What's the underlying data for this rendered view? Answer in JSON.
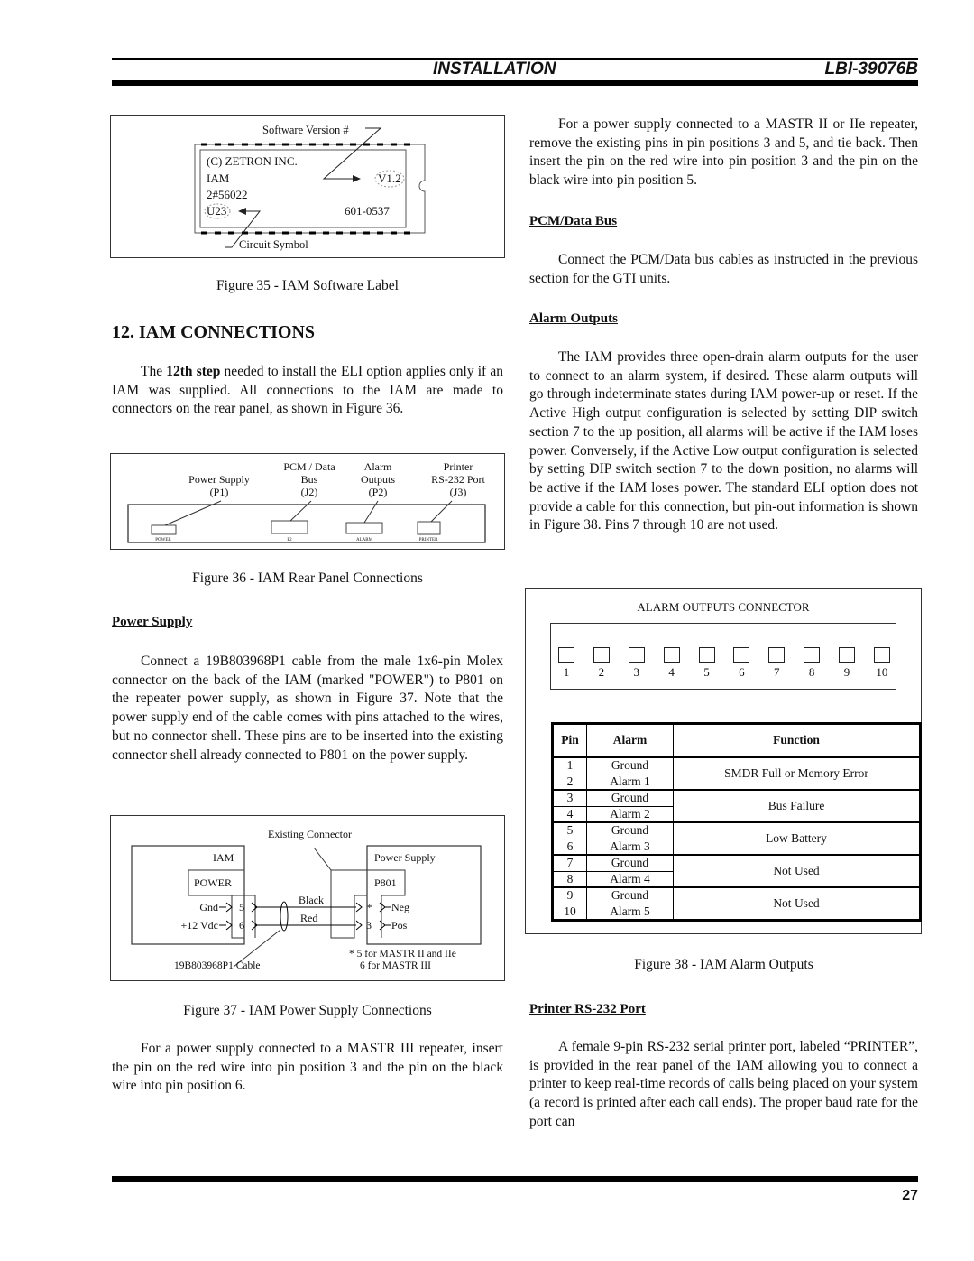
{
  "header": {
    "section": "INSTALLATION",
    "doc_number": "LBI-39076B"
  },
  "footer": {
    "page_number": "27"
  },
  "figure35": {
    "caption": "Figure 35 - IAM Software Label",
    "software_version_label": "Software Version #",
    "circuit_symbol_label": "Circuit Symbol",
    "chip_lines": [
      "(C) ZETRON INC.",
      "IAM",
      "2#56022",
      "U23"
    ],
    "version": "V1.2",
    "part_number": "601-0537"
  },
  "section12": {
    "title": "12. IAM CONNECTIONS",
    "intro_pre": "The ",
    "intro_bold": "12th step",
    "intro_post": " needed to install the ELI option applies only if an IAM was supplied.  All connections to the IAM are made to connectors on the rear panel, as shown in Figure 36."
  },
  "figure36": {
    "caption": "Figure 36 - IAM Rear Panel Connections",
    "connectors": [
      {
        "title_lines": [
          "Power Supply"
        ],
        "id": "(P1)",
        "panel_label": "POWER"
      },
      {
        "title_lines": [
          "PCM / Data",
          "Bus"
        ],
        "id": "(J2)",
        "panel_label": "P2"
      },
      {
        "title_lines": [
          "Alarm",
          "Outputs"
        ],
        "id": "(P2)",
        "panel_label": "ALARM"
      },
      {
        "title_lines": [
          "Printer",
          "RS-232 Port"
        ],
        "id": "(J3)",
        "panel_label": "PRINTER"
      }
    ]
  },
  "power_supply": {
    "heading": "Power Supply",
    "body": "Connect a 19B803968P1 cable from the male 1x6-pin Molex connector on the back of the IAM (marked \"POWER\") to P801 on the repeater power supply, as shown in Figure 37.  Note that the power supply end of the cable comes with pins attached to the wires, but no connector shell.  These pins are to be inserted into the existing connector shell already connected to P801 on the power supply."
  },
  "figure37": {
    "caption": "Figure 37 - IAM Power Supply Connections",
    "existing_connector": "Existing Connector",
    "iam_label": "IAM",
    "power_label": "POWER",
    "ps_label": "Power Supply",
    "p801_label": "P801",
    "gnd": "Gnd",
    "vdc": "+12 Vdc",
    "pin5": "5",
    "pin6": "6",
    "black": "Black",
    "red": "Red",
    "star": "*",
    "pin3": "3",
    "neg": "Neg",
    "pos": "Pos",
    "cable": "19B803968P1 Cable",
    "note1": "*  5 for MASTR II and IIe",
    "note2": "6 for MASTR III"
  },
  "mastr3_paragraph": "For a power supply connected to a MASTR III repeater, insert the pin on the red wire into pin position 3 and the pin on the black wire into pin position 6.",
  "mastr2_paragraph": "For a power supply connected to a MASTR II or IIe repeater, remove the existing pins in pin positions 3 and 5, and tie back.  Then insert the pin on the red wire into pin position 3 and the pin on the black wire into pin position 5.",
  "pcm": {
    "heading": "PCM/Data Bus",
    "body": "Connect the PCM/Data bus cables as instructed in the previous section for the GTI units."
  },
  "alarm_outputs": {
    "heading": "Alarm Outputs",
    "body": "The IAM provides three open-drain alarm outputs for the user to connect to an alarm system, if desired.  These alarm outputs will go through indeterminate states during IAM power-up or reset.  If the Active High output configuration is selected by setting DIP switch section 7 to the up position, all alarms will be active if the IAM loses power.  Conversely, if the Active Low output configuration is selected by setting DIP switch section 7 to the down position, no alarms will be active if the IAM loses power.  The standard ELI option does not provide a cable for this connection, but pin-out information is shown in Figure 38.  Pins 7 through 10 are not used."
  },
  "figure38": {
    "caption": "Figure 38 - IAM Alarm Outputs",
    "connector_title": "ALARM OUTPUTS CONNECTOR",
    "pins": [
      "1",
      "2",
      "3",
      "4",
      "5",
      "6",
      "7",
      "8",
      "9",
      "10"
    ],
    "table": {
      "headers": [
        "Pin",
        "Alarm",
        "Function"
      ],
      "rows": [
        {
          "pin": "1",
          "alarm": "Ground"
        },
        {
          "pin": "2",
          "alarm": "Alarm 1"
        },
        {
          "pin": "3",
          "alarm": "Ground"
        },
        {
          "pin": "4",
          "alarm": "Alarm 2"
        },
        {
          "pin": "5",
          "alarm": "Ground"
        },
        {
          "pin": "6",
          "alarm": "Alarm 3"
        },
        {
          "pin": "7",
          "alarm": "Ground"
        },
        {
          "pin": "8",
          "alarm": "Alarm 4"
        },
        {
          "pin": "9",
          "alarm": "Ground"
        },
        {
          "pin": "10",
          "alarm": "Alarm 5"
        }
      ],
      "functions": [
        "SMDR Full or Memory Error",
        "Bus Failure",
        "Low Battery",
        "Not Used",
        "Not Used"
      ]
    }
  },
  "printer": {
    "heading": "Printer RS-232 Port",
    "body": "A female 9-pin RS-232 serial printer port, labeled “PRINTER”, is provided in the rear panel of the IAM allowing you to connect a printer to keep real-time records of calls being placed on your system (a record is printed after each call ends).  The proper baud rate for the port can"
  }
}
